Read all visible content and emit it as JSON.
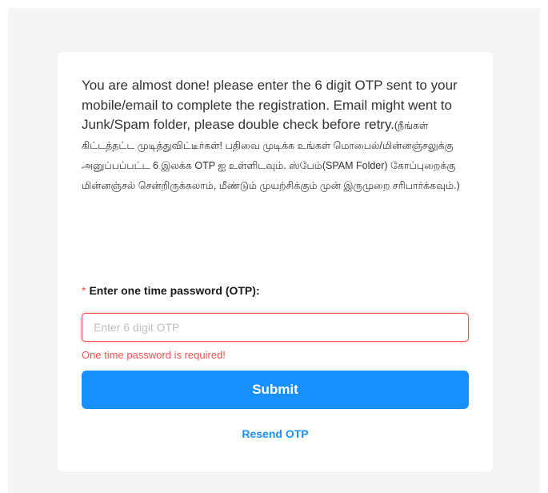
{
  "message": {
    "english": "You are almost done! please enter the 6 digit OTP sent to your mobile/email to complete the registration. Email might went to Junk/Spam folder, please double check before retry.",
    "tamil": "(நீங்கள் கிட்டத்தட்ட முடித்துவிட்டீர்கள்! பதிவை முடிக்க உங்கள் மொபைல்/மின்னஞ்சலுக்கு அனுப்பப்பட்ட 6 இலக்க OTP ஐ உள்ளிடவும். ஸ்பேம்(SPAM Folder) கோப்புறைக்கு மின்னஞ்சல் சென்றிருக்கலாம், மீண்டும் முயற்சிக்கும் முன் இருமுறை சரிபார்க்கவும்.)"
  },
  "form": {
    "required_mark": "*",
    "otp_label": "Enter one time password (OTP)",
    "otp_label_colon": ":",
    "otp_value": "",
    "otp_placeholder": "Enter 6 digit OTP",
    "error_text": "One time password is required!",
    "submit_label": "Submit",
    "resend_label": "Resend OTP"
  },
  "colors": {
    "primary": "#1890ff",
    "error": "#ff4d4f",
    "page_background": "#f5f5f5",
    "card_background": "#ffffff"
  }
}
